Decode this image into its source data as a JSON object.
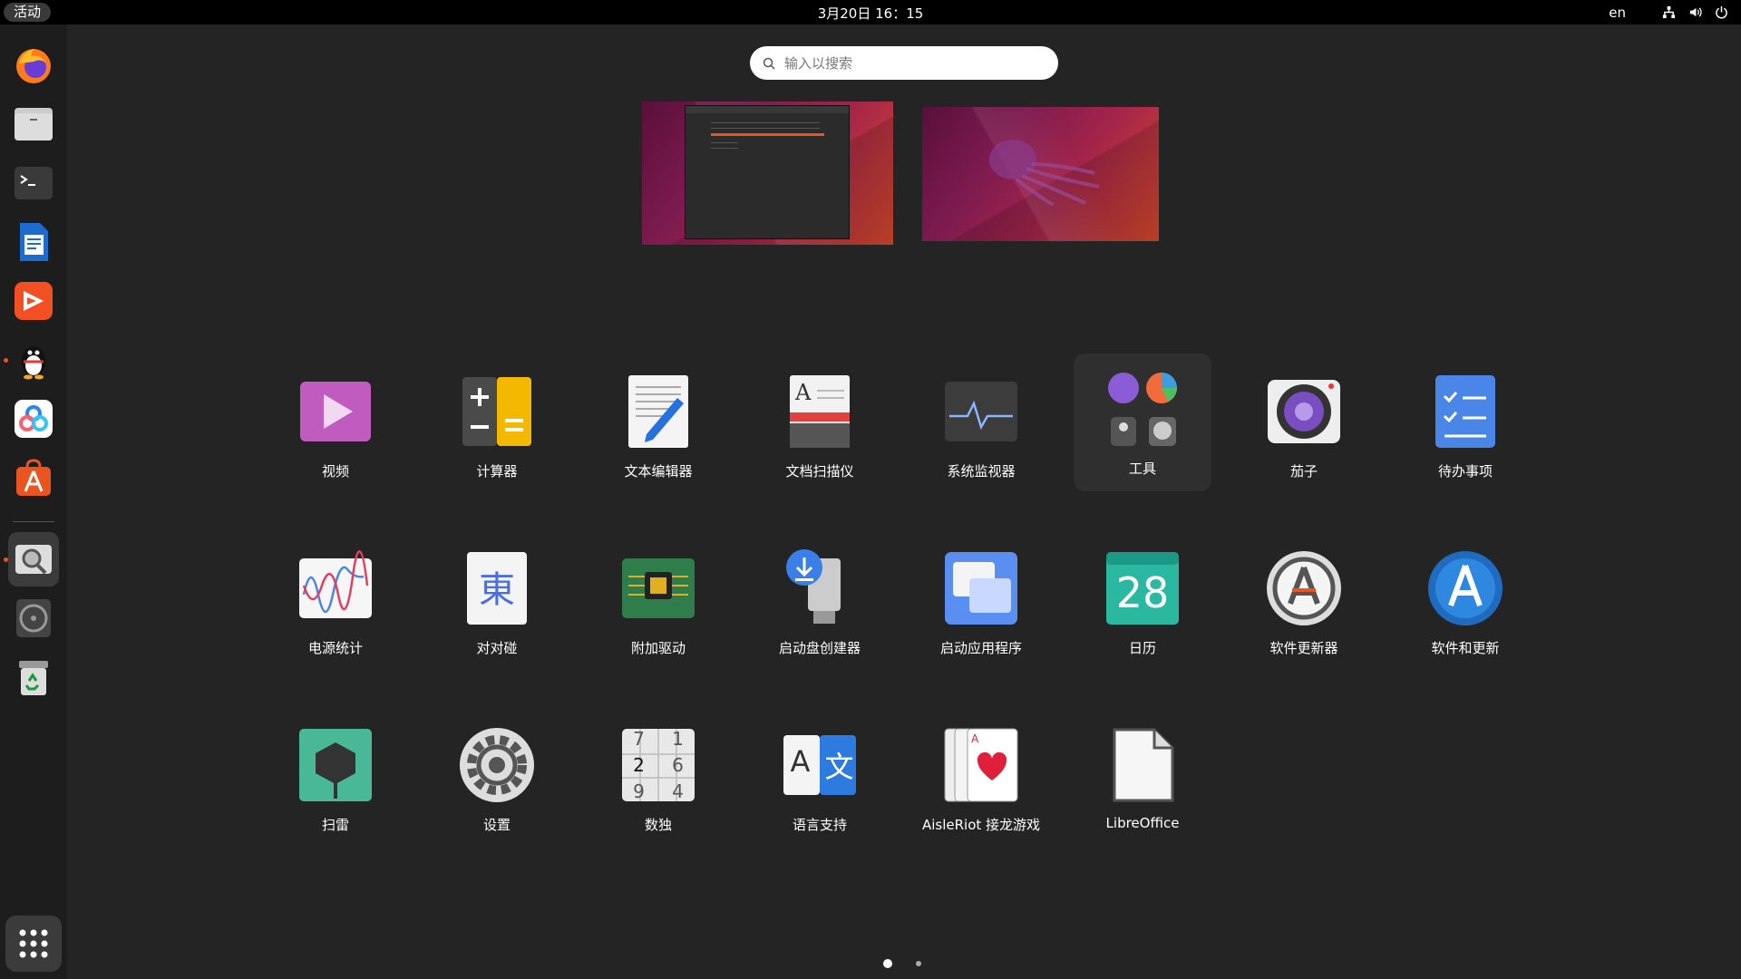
{
  "topbar": {
    "activities": "活动",
    "clock": "3月20日  16：15",
    "lang": "en"
  },
  "search": {
    "placeholder": "输入以搜索"
  },
  "apps": [
    {
      "label": "视频",
      "icon": "videos-icon"
    },
    {
      "label": "计算器",
      "icon": "calculator-icon"
    },
    {
      "label": "文本编辑器",
      "icon": "text-editor-icon"
    },
    {
      "label": "文档扫描仪",
      "icon": "document-scanner-icon"
    },
    {
      "label": "系统监视器",
      "icon": "system-monitor-icon"
    },
    {
      "label": "工具",
      "icon": "utilities-folder-icon"
    },
    {
      "label": "茄子",
      "icon": "cheese-icon"
    },
    {
      "label": "待办事项",
      "icon": "todo-icon"
    },
    {
      "label": "电源统计",
      "icon": "power-statistics-icon"
    },
    {
      "label": "对对碰",
      "icon": "mahjongg-icon"
    },
    {
      "label": "附加驱动",
      "icon": "additional-drivers-icon"
    },
    {
      "label": "启动盘创建器",
      "icon": "startup-disk-creator-icon"
    },
    {
      "label": "启动应用程序",
      "icon": "startup-applications-icon"
    },
    {
      "label": "日历",
      "icon": "calendar-icon",
      "day": "28"
    },
    {
      "label": "软件更新器",
      "icon": "software-updater-icon"
    },
    {
      "label": "软件和更新",
      "icon": "software-properties-icon"
    },
    {
      "label": "扫雷",
      "icon": "mines-icon"
    },
    {
      "label": "设置",
      "icon": "settings-icon"
    },
    {
      "label": "数独",
      "icon": "sudoku-icon",
      "digits": [
        "7",
        "1",
        "2",
        "6",
        "9",
        "4"
      ]
    },
    {
      "label": "语言支持",
      "icon": "language-support-icon",
      "glyphs": [
        "A",
        "文"
      ]
    },
    {
      "label": "AisleRiot 接龙游戏",
      "icon": "aisleriot-icon"
    },
    {
      "label": "LibreOffice",
      "icon": "libreoffice-icon"
    }
  ],
  "dock": [
    "firefox-icon",
    "files-icon",
    "terminal-icon",
    "writer-icon",
    "wps-icon",
    "qq-icon",
    "baidu-netdisk-icon",
    "app-store-icon",
    "image-viewer-icon",
    "disc-icon",
    "trash-icon",
    "show-apps-icon"
  ],
  "colors": {
    "accent": "#e95420",
    "background": "#242424",
    "dock": "#1d1d1d"
  }
}
